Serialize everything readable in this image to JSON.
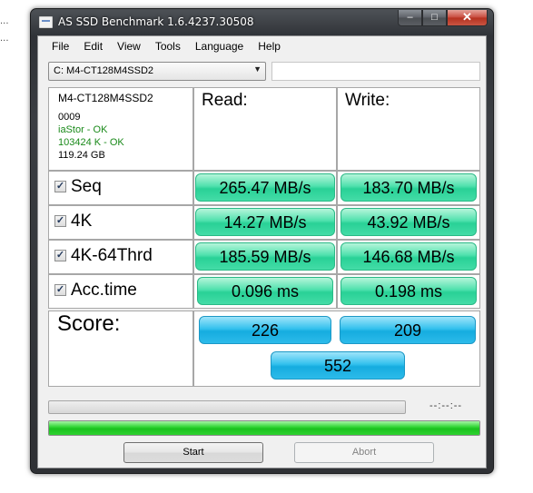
{
  "background": {
    "dots": [
      "...",
      "..."
    ]
  },
  "window": {
    "title": "AS SSD Benchmark 1.6.4237.30508",
    "buttons": {
      "minimize": "–",
      "maximize": "□",
      "close": "✕"
    }
  },
  "menu": [
    "File",
    "Edit",
    "View",
    "Tools",
    "Language",
    "Help"
  ],
  "drive": {
    "selected": "C: M4-CT128M4SSD2",
    "extra": ""
  },
  "info": {
    "model": "M4-CT128M4SSD2",
    "firmware": "0009",
    "driver": "iaStor - OK",
    "alignment": "103424 K - OK",
    "capacity": "119.24 GB"
  },
  "columns": {
    "read": "Read:",
    "write": "Write:"
  },
  "rows": [
    {
      "label": "Seq",
      "checked": true,
      "read": "265.47 MB/s",
      "write": "183.70 MB/s"
    },
    {
      "label": "4K",
      "checked": true,
      "read": "14.27 MB/s",
      "write": "43.92 MB/s"
    },
    {
      "label": "4K-64Thrd",
      "checked": true,
      "read": "185.59 MB/s",
      "write": "146.68 MB/s"
    },
    {
      "label": "Acc.time",
      "checked": true,
      "read": "0.096 ms",
      "write": "0.198 ms"
    }
  ],
  "score": {
    "label": "Score:",
    "read": "226",
    "write": "209",
    "total": "552"
  },
  "progress": {
    "time": "--:--:--",
    "current_percent": 0,
    "total_percent": 100
  },
  "actions": {
    "start": "Start",
    "abort": "Abort"
  },
  "colors": {
    "result_green": "#2fd69b",
    "score_blue": "#22b6e6",
    "progress_green": "#22c926"
  }
}
